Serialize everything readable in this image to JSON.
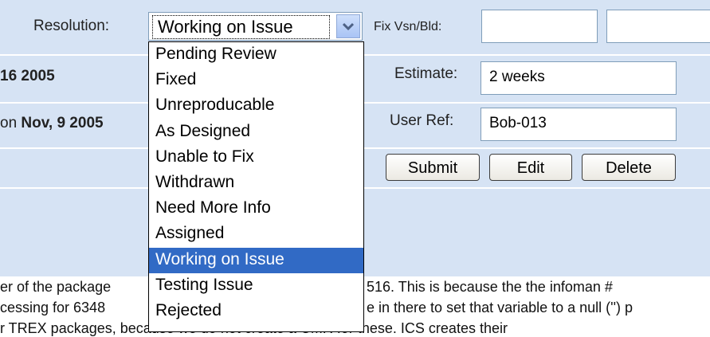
{
  "resolution": {
    "label": "Resolution:",
    "selected": "Working on Issue",
    "options": [
      "Pending Review",
      "Fixed",
      "Unreproducable",
      "As Designed",
      "Unable to Fix",
      "Withdrawn",
      "Need More Info",
      "Assigned",
      "Working on Issue",
      "Testing Issue",
      "Rejected"
    ]
  },
  "fix_version": {
    "label": "Fix Vsn/Bld:",
    "value1": "",
    "value2": ""
  },
  "estimate": {
    "label": "Estimate:",
    "value": "2 weeks"
  },
  "user_ref": {
    "label": "User Ref:",
    "value": "Bob-013"
  },
  "left_info": {
    "date1": "16 2005",
    "date2_prefix": "on ",
    "date2": "Nov, 9 2005"
  },
  "buttons": {
    "submit": "Submit",
    "edit": "Edit",
    "delete": "Delete"
  },
  "description": {
    "line1_left": "er of the package",
    "line1_right": "516.  This is because the the infoman #",
    "line2_left": "cessing for 6348",
    "line2_right": "e in there to set that variable to a null ('') p",
    "line3_left": "r TREX packages, because we do not create a CMR for these.  ICS creates their"
  },
  "colors": {
    "band": "#d6e3f4",
    "selected_option": "#316ac5"
  }
}
